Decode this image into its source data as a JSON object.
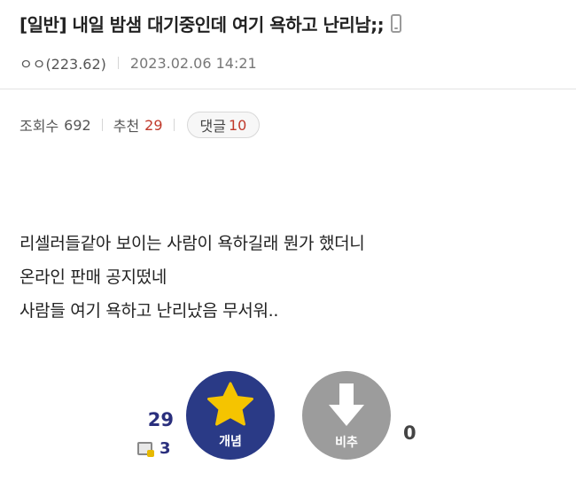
{
  "post": {
    "title": "[일반] 내일 밤샘 대기중인데 여기 욕하고 난리남;;",
    "writer": "ㅇㅇ(223.62)",
    "date": "2023.02.06 14:21"
  },
  "stats": {
    "views_label": "조회수",
    "views": "692",
    "recommend_label": "추천",
    "recommend": "29",
    "comment_label": "댓글",
    "comment_count": "10"
  },
  "body": {
    "lines": [
      "리셀러들같아 보이는 사람이 욕하길래 뭔가 했더니",
      "온라인 판매 공지떴네",
      "사람들 여기 욕하고 난리났음 무서워.."
    ]
  },
  "vote": {
    "up_count": "29",
    "fix_count": "3",
    "up_label": "개념",
    "down_label": "비추",
    "down_count": "0"
  },
  "icons": {
    "mobile": "mobile-phone-icon",
    "star": "star-icon",
    "down_arrow": "down-arrow-icon",
    "fix": "fixed-member-icon"
  },
  "colors": {
    "accent_navy": "#2a3a86",
    "count_red": "#c0392b",
    "down_gray": "#9c9c9c",
    "star_yellow": "#f5c400"
  }
}
